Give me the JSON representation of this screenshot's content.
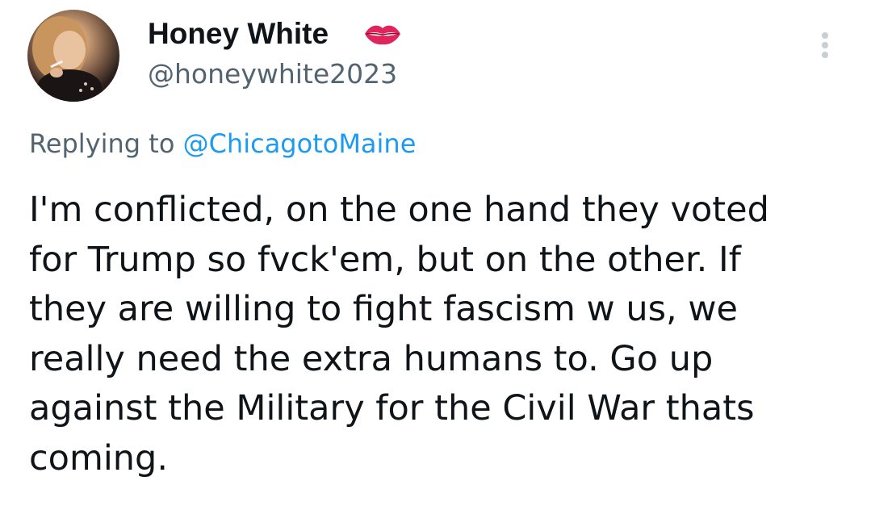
{
  "author": {
    "display_name": "Honey White",
    "handle": "@honeywhite2023",
    "badge_icon": "kissing-lips-icon"
  },
  "reply": {
    "prefix": "Replying to",
    "target": "@ChicagotoMaine"
  },
  "menu": {
    "icon": "more-options-icon"
  },
  "tweet": {
    "lines": [
      "I'm conflicted, on the one hand they voted",
      "for Trump so fvck'em, but on the other. If",
      "they are willing to fight fascism w us, we",
      "really need the extra humans to. Go up",
      "against the Military for the Civil War thats",
      "coming."
    ]
  },
  "colors": {
    "text_primary": "#0f1419",
    "text_secondary": "#536471",
    "link": "#1d9bf0",
    "lips": "#e0245e"
  }
}
